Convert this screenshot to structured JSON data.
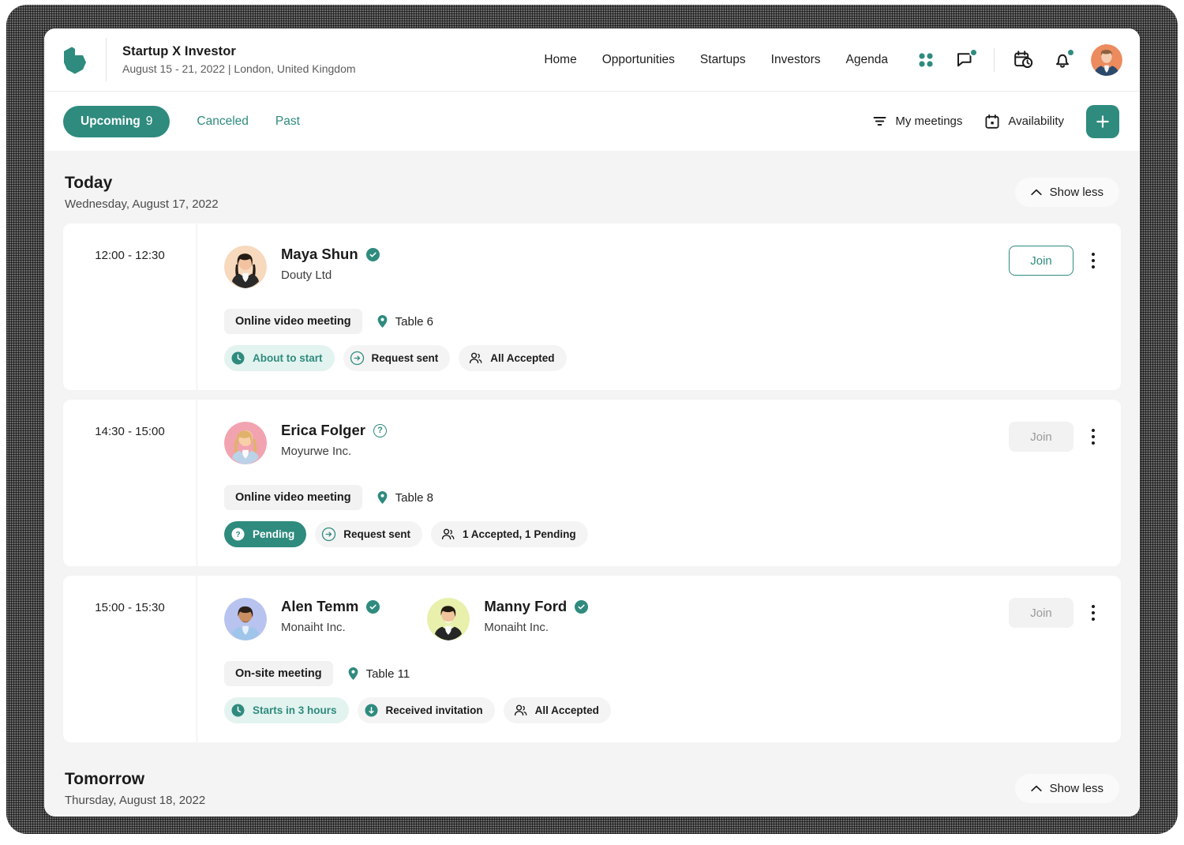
{
  "header": {
    "logo_icon": "brand-logo-icon",
    "title": "Startup X Investor",
    "subtitle": "August 15 - 21, 2022 | London, United Kingdom",
    "nav": [
      {
        "label": "Home",
        "name": "nav-home"
      },
      {
        "label": "Opportunities",
        "name": "nav-opportunities"
      },
      {
        "label": "Startups",
        "name": "nav-startups"
      },
      {
        "label": "Investors",
        "name": "nav-investors"
      },
      {
        "label": "Agenda",
        "name": "nav-agenda"
      }
    ],
    "icons": [
      {
        "name": "apps-grid-icon",
        "badge": false
      },
      {
        "name": "chat-bubble-icon",
        "badge": true
      },
      {
        "name": "calendar-clock-icon",
        "badge": false
      },
      {
        "name": "bell-notification-icon",
        "badge": true
      }
    ],
    "avatar_name": "user-avatar"
  },
  "tabbar": {
    "tabs": [
      {
        "label": "Upcoming",
        "count": "9",
        "active": true
      },
      {
        "label": "Canceled",
        "count": "",
        "active": false
      },
      {
        "label": "Past",
        "count": "",
        "active": false
      }
    ],
    "my_meetings_label": "My meetings",
    "availability_label": "Availability",
    "add_label": "+"
  },
  "colors": {
    "accent": "#2e8b7e",
    "accent_soft": "#e3f3ef",
    "page_bg": "#f4f4f4",
    "card_bg": "#ffffff",
    "text": "#1b1b1b",
    "muted": "#5c5c5c"
  },
  "sections": [
    {
      "title": "Today",
      "subtitle": "Wednesday, August 17, 2022",
      "toggle_label": "Show less",
      "meetings": [
        {
          "time": "12:00 - 12:30",
          "people": [
            {
              "name": "Maya Shun",
              "company": "Douty Ltd",
              "status_icon": "verified-check-icon",
              "avatar": "maya"
            }
          ],
          "type": "Online video meeting",
          "table": "Table 6",
          "badges": [
            {
              "label": "About to start",
              "style": "mint",
              "icon": "clock-icon"
            },
            {
              "label": "Request sent",
              "style": "grey",
              "icon": "arrow-right-circle-icon"
            },
            {
              "label": "All Accepted",
              "style": "plain",
              "icon": "people-icon"
            }
          ],
          "join_label": "Join",
          "join_enabled": true
        },
        {
          "time": "14:30 - 15:00",
          "people": [
            {
              "name": "Erica Folger",
              "company": "Moyurwe Inc.",
              "status_icon": "question-circle-icon",
              "avatar": "erica"
            }
          ],
          "type": "Online video meeting",
          "table": "Table 8",
          "badges": [
            {
              "label": "Pending",
              "style": "solid",
              "icon": "question-badge-icon"
            },
            {
              "label": "Request sent",
              "style": "grey",
              "icon": "arrow-right-circle-icon"
            },
            {
              "label": "1 Accepted, 1 Pending",
              "style": "plain",
              "icon": "people-icon"
            }
          ],
          "join_label": "Join",
          "join_enabled": false
        },
        {
          "time": "15:00 - 15:30",
          "people": [
            {
              "name": "Alen Temm",
              "company": "Monaiht Inc.",
              "status_icon": "verified-check-icon",
              "avatar": "alen"
            },
            {
              "name": "Manny Ford",
              "company": "Monaiht Inc.",
              "status_icon": "verified-check-icon",
              "avatar": "manny"
            }
          ],
          "type": "On-site meeting",
          "table": "Table 11",
          "badges": [
            {
              "label": "Starts in 3 hours",
              "style": "mint",
              "icon": "clock-icon"
            },
            {
              "label": "Received invitation",
              "style": "grey",
              "icon": "arrow-down-circle-icon"
            },
            {
              "label": "All Accepted",
              "style": "plain",
              "icon": "people-icon"
            }
          ],
          "join_label": "Join",
          "join_enabled": false
        }
      ]
    },
    {
      "title": "Tomorrow",
      "subtitle": "Thursday, August 18, 2022",
      "toggle_label": "Show less",
      "meetings": []
    }
  ]
}
